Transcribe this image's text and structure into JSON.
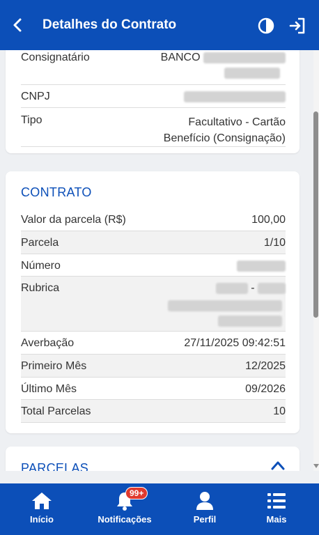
{
  "header": {
    "title": "Detalhes do Contrato"
  },
  "consignatario": {
    "rows": [
      {
        "label": "Consignatário",
        "value_prefix": "BANCO"
      },
      {
        "label": "CNPJ"
      },
      {
        "label": "Tipo",
        "value_line1": "Facultativo - Cartão",
        "value_line2": "Benefício (Consignação)"
      }
    ]
  },
  "contrato": {
    "title": "CONTRATO",
    "valor_label": "Valor da parcela (R$)",
    "valor_value": "100,00",
    "parcela_label": "Parcela",
    "parcela_value": "1/10",
    "numero_label": "Número",
    "rubrica_label": "Rubrica",
    "rubrica_sep": "-",
    "averbacao_label": "Averbação",
    "averbacao_value": "27/11/2025 09:42:51",
    "primeiro_label": "Primeiro Mês",
    "primeiro_value": "12/2025",
    "ultimo_label": "Último Mês",
    "ultimo_value": "09/2026",
    "total_label": "Total Parcelas",
    "total_value": "10"
  },
  "parcelas": {
    "title": "PARCELAS"
  },
  "bottom_nav": {
    "inicio": "Início",
    "notificacoes": "Notificações",
    "notificacoes_badge": "99+",
    "perfil": "Perfil",
    "mais": "Mais"
  },
  "colors": {
    "primary": "#0c4fb8",
    "badge": "#e03a2e"
  }
}
